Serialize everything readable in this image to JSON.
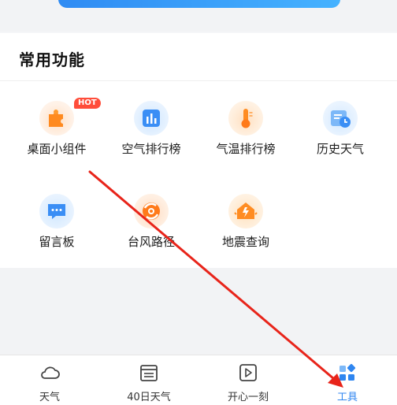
{
  "section": {
    "title": "常用功能"
  },
  "tools": [
    {
      "label": "桌面小组件",
      "icon": "puzzle-icon",
      "badge": "HOT"
    },
    {
      "label": "空气排行榜",
      "icon": "bar-chart-icon"
    },
    {
      "label": "气温排行榜",
      "icon": "thermometer-icon"
    },
    {
      "label": "历史天气",
      "icon": "calendar-clock-icon"
    },
    {
      "label": "留言板",
      "icon": "message-board-icon"
    },
    {
      "label": "台风路径",
      "icon": "typhoon-icon"
    },
    {
      "label": "地震查询",
      "icon": "earthquake-icon"
    }
  ],
  "nav": [
    {
      "label": "天气",
      "icon": "cloud-icon"
    },
    {
      "label": "40日天气",
      "icon": "calendar-icon"
    },
    {
      "label": "开心一刻",
      "icon": "play-icon"
    },
    {
      "label": "工具",
      "icon": "tools-icon",
      "active": true
    }
  ],
  "colors": {
    "accent": "#2f86f0",
    "hot_badge": "#ff4d3a",
    "annotation_arrow": "#e8241a"
  }
}
